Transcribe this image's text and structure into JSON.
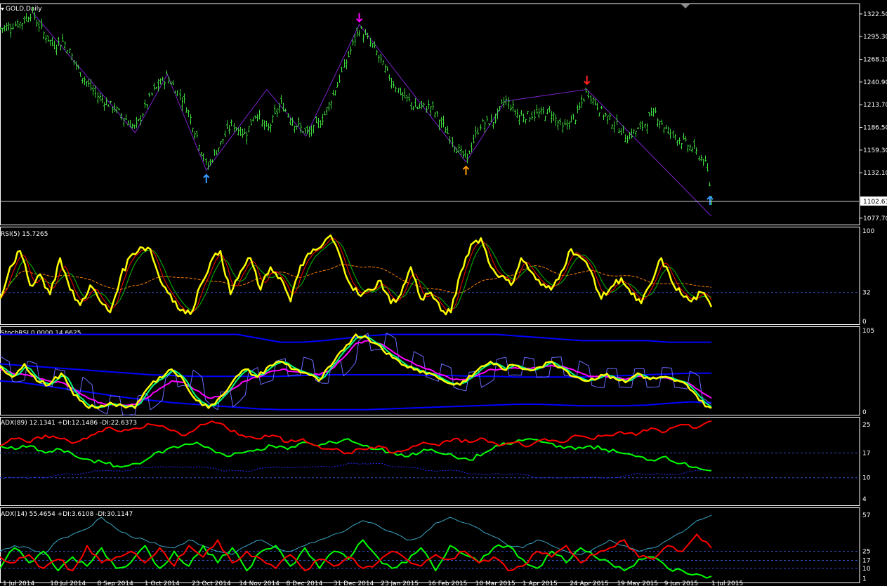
{
  "colors": {
    "background": "#000000",
    "frame": "#ffffff",
    "bar": "#3cd83c",
    "rsi": "#ffff00",
    "rsi_fast": "#ff0000",
    "rsi_mid": "#00c000",
    "rsi_slow": "#ff8000",
    "stoch_main": "#ffff00",
    "stoch_signal": "#00ff80",
    "stoch_slow": "#ff00ff",
    "band": "#0000ff",
    "band_thin": "#6a6aff",
    "plus_di": "#00ff00",
    "minus_di": "#ff0000",
    "adx_line": "#2a2aff",
    "adx14_line": "#3aa8c8",
    "zigzag": "#7a20c8",
    "arrow_up_blue": "#3a9cff",
    "arrow_up_orange": "#ff9c00",
    "arrow_down_red": "#ff2020",
    "arrow_down_magenta": "#ff00ff",
    "level_line": "#3050c0"
  },
  "chart_data": [
    {
      "type": "candlestick",
      "title": "GOLD,Daily",
      "y_ticks": [
        "1322.50",
        "1295.30",
        "1268.10",
        "1240.90",
        "1213.70",
        "1186.50",
        "1159.30",
        "1132.10",
        "1077.70"
      ],
      "ylim": [
        1070,
        1335
      ],
      "current_price": "1102.63",
      "close_path": [
        {
          "t": 0,
          "v": 1305
        },
        {
          "t": 0.03,
          "v": 1312
        },
        {
          "t": 0.045,
          "v": 1325
        },
        {
          "t": 0.06,
          "v": 1300
        },
        {
          "t": 0.075,
          "v": 1285
        },
        {
          "t": 0.09,
          "v": 1290
        },
        {
          "t": 0.11,
          "v": 1255
        },
        {
          "t": 0.135,
          "v": 1225
        },
        {
          "t": 0.16,
          "v": 1210
        },
        {
          "t": 0.19,
          "v": 1185
        },
        {
          "t": 0.215,
          "v": 1230
        },
        {
          "t": 0.235,
          "v": 1248
        },
        {
          "t": 0.26,
          "v": 1215
        },
        {
          "t": 0.28,
          "v": 1168
        },
        {
          "t": 0.29,
          "v": 1138
        },
        {
          "t": 0.305,
          "v": 1160
        },
        {
          "t": 0.325,
          "v": 1190
        },
        {
          "t": 0.345,
          "v": 1178
        },
        {
          "t": 0.36,
          "v": 1205
        },
        {
          "t": 0.375,
          "v": 1182
        },
        {
          "t": 0.395,
          "v": 1215
        },
        {
          "t": 0.415,
          "v": 1190
        },
        {
          "t": 0.435,
          "v": 1178
        },
        {
          "t": 0.455,
          "v": 1200
        },
        {
          "t": 0.475,
          "v": 1240
        },
        {
          "t": 0.495,
          "v": 1285
        },
        {
          "t": 0.505,
          "v": 1305
        },
        {
          "t": 0.525,
          "v": 1282
        },
        {
          "t": 0.545,
          "v": 1250
        },
        {
          "t": 0.565,
          "v": 1225
        },
        {
          "t": 0.585,
          "v": 1210
        },
        {
          "t": 0.605,
          "v": 1212
        },
        {
          "t": 0.625,
          "v": 1185
        },
        {
          "t": 0.645,
          "v": 1158
        },
        {
          "t": 0.655,
          "v": 1148
        },
        {
          "t": 0.675,
          "v": 1190
        },
        {
          "t": 0.695,
          "v": 1195
        },
        {
          "t": 0.71,
          "v": 1220
        },
        {
          "t": 0.73,
          "v": 1200
        },
        {
          "t": 0.755,
          "v": 1202
        },
        {
          "t": 0.775,
          "v": 1205
        },
        {
          "t": 0.79,
          "v": 1185
        },
        {
          "t": 0.81,
          "v": 1200
        },
        {
          "t": 0.825,
          "v": 1230
        },
        {
          "t": 0.845,
          "v": 1205
        },
        {
          "t": 0.865,
          "v": 1190
        },
        {
          "t": 0.88,
          "v": 1175
        },
        {
          "t": 0.9,
          "v": 1185
        },
        {
          "t": 0.92,
          "v": 1205
        },
        {
          "t": 0.935,
          "v": 1185
        },
        {
          "t": 0.955,
          "v": 1172
        },
        {
          "t": 0.975,
          "v": 1160
        },
        {
          "t": 0.99,
          "v": 1145
        },
        {
          "t": 0.995,
          "v": 1130
        },
        {
          "t": 1.0,
          "v": 1100
        }
      ],
      "zigzag": [
        {
          "t": 0.045,
          "v": 1325
        },
        {
          "t": 0.19,
          "v": 1180
        },
        {
          "t": 0.235,
          "v": 1250
        },
        {
          "t": 0.29,
          "v": 1135
        },
        {
          "t": 0.375,
          "v": 1232
        },
        {
          "t": 0.43,
          "v": 1176
        },
        {
          "t": 0.505,
          "v": 1310
        },
        {
          "t": 0.655,
          "v": 1145
        },
        {
          "t": 0.71,
          "v": 1218
        },
        {
          "t": 0.825,
          "v": 1232
        },
        {
          "t": 1.0,
          "v": 1080
        }
      ],
      "signals": [
        {
          "t": 0.29,
          "dir": "up",
          "color": "blue"
        },
        {
          "t": 0.505,
          "dir": "down",
          "color": "magenta"
        },
        {
          "t": 0.655,
          "dir": "up",
          "color": "orange"
        },
        {
          "t": 0.825,
          "dir": "down",
          "color": "red"
        },
        {
          "t": 0.998,
          "dir": "up",
          "color": "blue"
        }
      ]
    },
    {
      "type": "line",
      "title": "RSI(5) 15.7265",
      "ylim": [
        0,
        100
      ],
      "y_ticks": [
        "100",
        "32",
        "0"
      ],
      "levels": [
        32
      ],
      "series": [
        {
          "key": "rsi",
          "values": [
            25,
            60,
            78,
            40,
            52,
            30,
            70,
            35,
            18,
            40,
            22,
            10,
            48,
            72,
            82,
            80,
            45,
            30,
            12,
            8,
            40,
            65,
            78,
            30,
            55,
            70,
            35,
            60,
            48,
            22,
            62,
            75,
            82,
            95,
            70,
            40,
            28,
            35,
            45,
            20,
            30,
            60,
            25,
            32,
            12,
            10,
            55,
            85,
            92,
            60,
            50,
            40,
            70,
            55,
            40,
            35,
            55,
            80,
            70,
            55,
            25,
            38,
            48,
            30,
            20,
            42,
            70,
            45,
            30,
            22,
            32,
            16
          ]
        }
      ]
    },
    {
      "type": "line",
      "title": "StochRSI 0.0000 14.6625",
      "ylim": [
        0,
        105
      ],
      "y_ticks": [
        "105",
        "0"
      ],
      "levels": [],
      "series": [
        {
          "key": "stoch",
          "values": [
            60,
            45,
            62,
            40,
            35,
            50,
            22,
            8,
            5,
            12,
            8,
            5,
            30,
            45,
            55,
            40,
            15,
            5,
            20,
            40,
            55,
            45,
            60,
            65,
            55,
            50,
            40,
            60,
            80,
            100,
            95,
            85,
            70,
            60,
            55,
            50,
            42,
            35,
            40,
            55,
            65,
            55,
            60,
            55,
            58,
            65,
            55,
            45,
            40,
            48,
            45,
            38,
            50,
            42,
            45,
            40,
            35,
            15,
            5
          ]
        },
        {
          "key": "stoch_slow",
          "values": [
            55,
            50,
            48,
            45,
            40,
            38,
            30,
            20,
            12,
            10,
            9,
            10,
            18,
            30,
            40,
            38,
            28,
            18,
            20,
            30,
            40,
            45,
            52,
            55,
            52,
            50,
            48,
            55,
            70,
            88,
            92,
            88,
            78,
            68,
            60,
            55,
            48,
            42,
            42,
            48,
            55,
            55,
            57,
            56,
            57,
            60,
            58,
            52,
            46,
            46,
            45,
            42,
            46,
            44,
            44,
            42,
            38,
            28,
            18
          ]
        },
        {
          "key": "band_top",
          "values": [
            100,
            100,
            100,
            100,
            100,
            100,
            100,
            100,
            100,
            100,
            100,
            100,
            95,
            90,
            90,
            92,
            95,
            98,
            100,
            100,
            100,
            100,
            100,
            100,
            98,
            96,
            94,
            92,
            92,
            92,
            92,
            90,
            90,
            90
          ]
        },
        {
          "key": "band_mid",
          "values": [
            62,
            60,
            58,
            56,
            54,
            52,
            50,
            48,
            47,
            46,
            46,
            46,
            46,
            46,
            47,
            48,
            48,
            48,
            48,
            48,
            47,
            47,
            46,
            46,
            45,
            45,
            45,
            45,
            46,
            47,
            48,
            49,
            50,
            50
          ]
        },
        {
          "key": "band_low",
          "values": [
            40,
            38,
            34,
            30,
            26,
            22,
            18,
            15,
            12,
            10,
            8,
            6,
            4,
            3,
            3,
            3,
            3,
            3,
            4,
            5,
            6,
            7,
            8,
            9,
            10,
            10,
            9,
            8,
            8,
            8,
            9,
            11,
            13,
            12
          ]
        }
      ]
    },
    {
      "type": "line",
      "title": "ADX(89) 12.1341 +DI:12.1486 -DI:22.6373",
      "ylim": [
        3,
        26
      ],
      "y_ticks": [
        "25",
        "17",
        "10",
        "4"
      ],
      "levels": [
        17,
        10
      ],
      "series": [
        {
          "key": "minus_di",
          "values": [
            19,
            21,
            20,
            22,
            21,
            20,
            22,
            24,
            23,
            24,
            25,
            24,
            22,
            24,
            26,
            24,
            22,
            21,
            22,
            20,
            21,
            19,
            18,
            17,
            18,
            19,
            17,
            18,
            20,
            19,
            21,
            20,
            21,
            19,
            20,
            19,
            21,
            20,
            22,
            21,
            22,
            23,
            22,
            24,
            23,
            25,
            24,
            26
          ]
        },
        {
          "key": "plus_di",
          "values": [
            19,
            18,
            19,
            17,
            18,
            16,
            15,
            14,
            13,
            14,
            16,
            18,
            19,
            20,
            18,
            16,
            17,
            18,
            19,
            18,
            20,
            19,
            20,
            21,
            19,
            18,
            17,
            16,
            18,
            17,
            16,
            15,
            17,
            19,
            20,
            21,
            20,
            19,
            18,
            19,
            18,
            17,
            16,
            15,
            16,
            14,
            13,
            12
          ]
        },
        {
          "key": "adx",
          "values": [
            10,
            10,
            10,
            10,
            11,
            11,
            12,
            12,
            12,
            13,
            13,
            13,
            13,
            13,
            12,
            12,
            12,
            13,
            13,
            13,
            13,
            13,
            14,
            14,
            14,
            13,
            13,
            12,
            12,
            12,
            11,
            11,
            11,
            11,
            10,
            10,
            10,
            10,
            10,
            10,
            11,
            11,
            11,
            11,
            12,
            12
          ]
        }
      ]
    },
    {
      "type": "line",
      "title": "ADX(14) 55.4654 +DI:3.6108 -DI:30.1147",
      "ylim": [
        0,
        60
      ],
      "y_ticks": [
        "57",
        "25",
        "17",
        "10",
        "1"
      ],
      "levels": [
        25,
        17,
        10
      ],
      "series": [
        {
          "key": "minus_di",
          "values": [
            20,
            15,
            22,
            10,
            18,
            8,
            30,
            15,
            20,
            25,
            15,
            28,
            12,
            30,
            20,
            35,
            15,
            25,
            18,
            10,
            22,
            8,
            18,
            12,
            20,
            10,
            15,
            25,
            18,
            12,
            22,
            18,
            25,
            15,
            20,
            8,
            12,
            25,
            20,
            30,
            15,
            22,
            28,
            35,
            20,
            18,
            30,
            25,
            40,
            28
          ]
        },
        {
          "key": "plus_di",
          "values": [
            10,
            28,
            15,
            25,
            8,
            20,
            12,
            28,
            10,
            15,
            30,
            10,
            25,
            12,
            30,
            15,
            28,
            8,
            25,
            30,
            12,
            28,
            10,
            25,
            18,
            35,
            20,
            10,
            15,
            28,
            8,
            30,
            22,
            15,
            28,
            30,
            18,
            10,
            25,
            15,
            28,
            20,
            15,
            8,
            18,
            20,
            10,
            8,
            5,
            3
          ]
        },
        {
          "key": "adx",
          "values": [
            25,
            30,
            28,
            22,
            35,
            40,
            45,
            55,
            45,
            38,
            35,
            30,
            28,
            35,
            30,
            25,
            22,
            30,
            35,
            28,
            25,
            30,
            35,
            40,
            45,
            52,
            48,
            42,
            35,
            38,
            50,
            55,
            50,
            45,
            38,
            30,
            28,
            35,
            30,
            25,
            22,
            28,
            35,
            30,
            25,
            28,
            35,
            42,
            52,
            57
          ]
        }
      ]
    }
  ],
  "x_axis_labels": [
    "1 Jul 2014",
    "18 Jul 2014",
    "8 Sep 2014",
    "1 Oct 2014",
    "23 Oct 2014",
    "14 Nov 2014",
    "8 Dec 2014",
    "31 Dec 2014",
    "23 Jan 2015",
    "16 Feb 2015",
    "10 Mar 2015",
    "1 Apr 2015",
    "24 Apr 2015",
    "19 May 2015",
    "9 Jun 2015",
    "1 Jul 2015"
  ]
}
